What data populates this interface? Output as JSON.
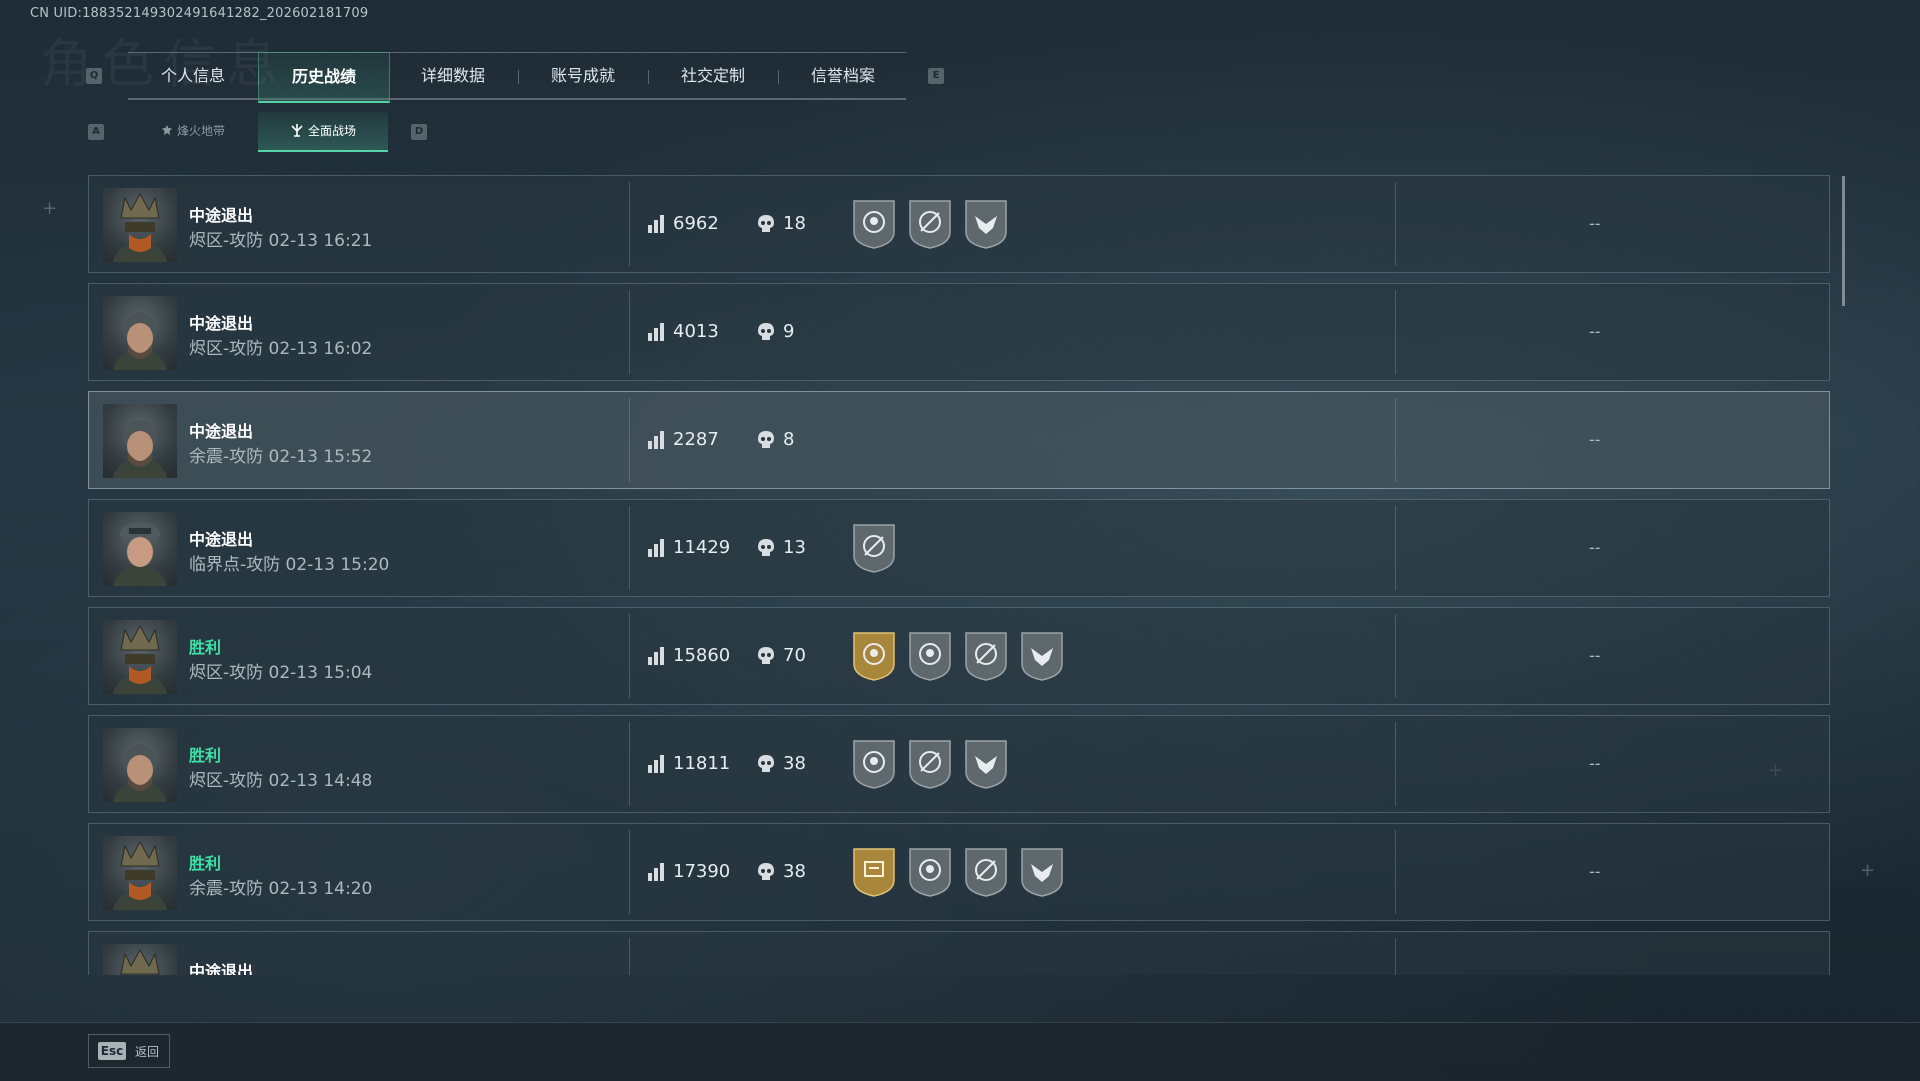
{
  "uid_text": "CN UID:18835214930249164128​2_202602181709",
  "header_bg_text": "角色信息",
  "tabs": {
    "left_key": "Q",
    "right_key": "E",
    "items": [
      {
        "label": "个人信息"
      },
      {
        "label": "历史战绩",
        "active": true
      },
      {
        "label": "详细数据"
      },
      {
        "label": "账号成就"
      },
      {
        "label": "社交定制"
      },
      {
        "label": "信誉档案"
      }
    ]
  },
  "subtabs": {
    "left_key": "A",
    "right_key": "D",
    "items": [
      {
        "label": "烽火地带",
        "icon": "extraction-mode-icon"
      },
      {
        "label": "全面战场",
        "icon": "battlefield-mode-icon",
        "active": true
      }
    ]
  },
  "matches": [
    {
      "result": "中途退出",
      "win": false,
      "detail": "烬区-攻防 02-13 16:21",
      "score": "6962",
      "kills": "18",
      "avatar": "crowned-operator",
      "badges": [
        "skull-badge",
        "crosshair-badge",
        "eagle-badge"
      ],
      "extra": "--"
    },
    {
      "result": "中途退出",
      "win": false,
      "detail": "烬区-攻防 02-13 16:02",
      "score": "4013",
      "kills": "9",
      "avatar": "bearded-operator",
      "badges": [],
      "extra": "--"
    },
    {
      "result": "中途退出",
      "win": false,
      "detail": "余震-攻防 02-13 15:52",
      "score": "2287",
      "kills": "8",
      "avatar": "bearded-operator",
      "badges": [],
      "extra": "--",
      "highlight": true
    },
    {
      "result": "中途退出",
      "win": false,
      "detail": "临界点-攻防 02-13 15:20",
      "score": "11429",
      "kills": "13",
      "avatar": "female-operator",
      "badges": [
        "crosshair-badge"
      ],
      "extra": "--"
    },
    {
      "result": "胜利",
      "win": true,
      "detail": "烬区-攻防 02-13 15:04",
      "score": "15860",
      "kills": "70",
      "avatar": "crowned-operator",
      "badges": [
        "gold-mvp-badge",
        "skull-badge",
        "crosshair-badge",
        "eagle-badge"
      ],
      "extra": "--"
    },
    {
      "result": "胜利",
      "win": true,
      "detail": "烬区-攻防 02-13 14:48",
      "score": "11811",
      "kills": "38",
      "avatar": "bearded-operator",
      "badges": [
        "skull-badge",
        "crosshair-badge",
        "eagle-badge"
      ],
      "extra": "--"
    },
    {
      "result": "胜利",
      "win": true,
      "detail": "余震-攻防 02-13 14:20",
      "score": "17390",
      "kills": "38",
      "avatar": "crowned-operator",
      "badges": [
        "gold-support-badge",
        "skull-badge",
        "crosshair-badge",
        "eagle-badge"
      ],
      "extra": "--"
    },
    {
      "result": "中途退出",
      "win": false,
      "detail": "",
      "score": "",
      "kills": "",
      "avatar": "crowned-operator",
      "badges": [],
      "extra": ""
    }
  ],
  "footer": {
    "key": "Esc",
    "label": "返回"
  },
  "colors": {
    "accent": "#57d3a7",
    "win": "#3fe0a4",
    "gold_badge": "#b08a3a",
    "grey_badge": "#6d777c"
  }
}
